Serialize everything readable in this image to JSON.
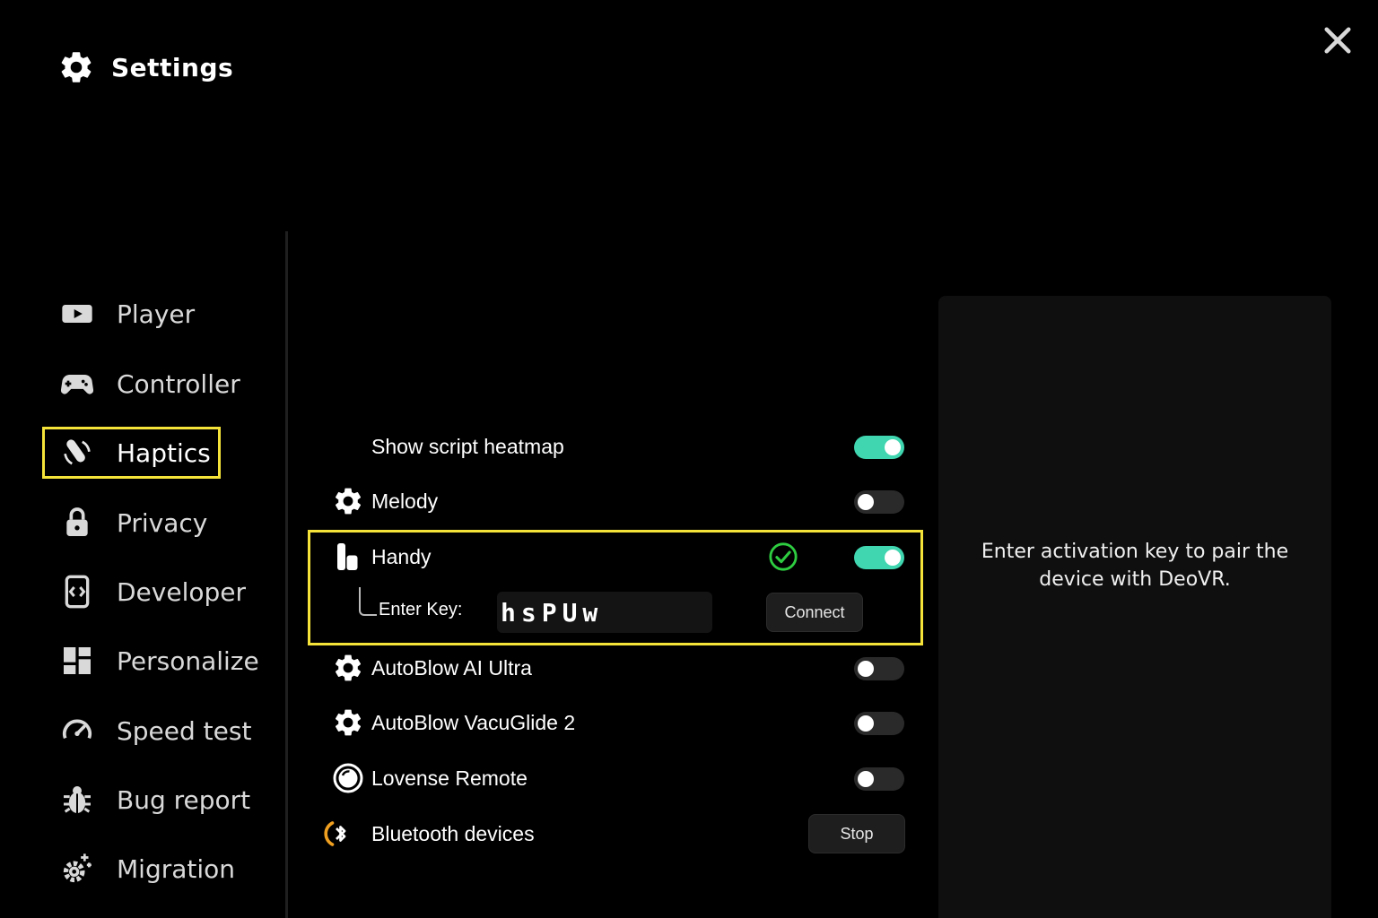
{
  "header": {
    "title": "Settings",
    "icon": "gear-icon"
  },
  "close": {
    "icon": "close-icon"
  },
  "sidebar": {
    "items": [
      {
        "label": "Player",
        "icon": "play-icon",
        "active": false
      },
      {
        "label": "Controller",
        "icon": "gamepad-icon",
        "active": false
      },
      {
        "label": "Haptics",
        "icon": "haptics-icon",
        "active": true
      },
      {
        "label": "Privacy",
        "icon": "lock-icon",
        "active": false
      },
      {
        "label": "Developer",
        "icon": "code-icon",
        "active": false
      },
      {
        "label": "Personalize",
        "icon": "dashboard-icon",
        "active": false
      },
      {
        "label": "Speed test",
        "icon": "speedometer-icon",
        "active": false
      },
      {
        "label": "Bug report",
        "icon": "bug-icon",
        "active": false
      },
      {
        "label": "Migration",
        "icon": "migration-gear-icon",
        "active": false
      }
    ]
  },
  "haptics": {
    "heatmap": {
      "label": "Show script heatmap",
      "enabled": true
    },
    "devices": [
      {
        "label": "Melody",
        "icon": "gear-icon",
        "enabled": false
      },
      {
        "label": "Handy",
        "icon": "handy-device-icon",
        "enabled": true,
        "connected": true
      },
      {
        "label": "AutoBlow AI Ultra",
        "icon": "gear-icon",
        "enabled": false
      },
      {
        "label": "AutoBlow VacuGlide 2",
        "icon": "gear-icon",
        "enabled": false
      },
      {
        "label": "Lovense Remote",
        "icon": "lovense-icon",
        "enabled": false
      }
    ],
    "handy_key": {
      "label": "Enter Key:",
      "value": "hsPUw",
      "connect_label": "Connect"
    },
    "bluetooth": {
      "label": "Bluetooth devices",
      "icon": "bluetooth-scan-icon",
      "stop_label": "Stop"
    }
  },
  "info": {
    "text": "Enter activation key to pair the device with DeoVR."
  },
  "colors": {
    "accent": "#3fd6b0",
    "highlight": "#f5e33a",
    "success": "#2ecc40",
    "background": "#000000",
    "bluetooth": "#f0a020"
  }
}
